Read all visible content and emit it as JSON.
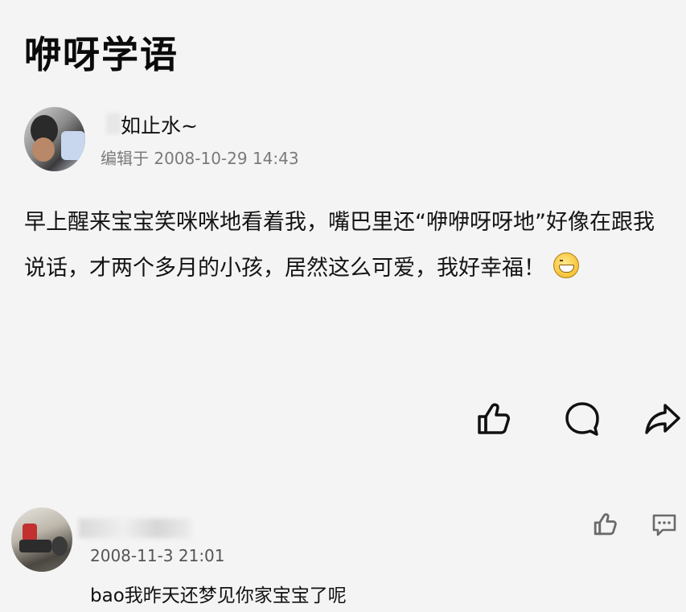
{
  "post": {
    "title": "咿呀学语",
    "author": {
      "name": "如止水~"
    },
    "edited_time": "编辑于 2008-10-29 14:43",
    "body": "早上醒来宝宝笑咪咪地看着我，嘴巴里还“咿咿呀呀地”好像在跟我说话，才两个多月的小孩，居然这么可爱，我好幸福！",
    "emoji_icon": "grinning-face-icon"
  },
  "actions": {
    "like_icon": "thumbs-up-icon",
    "comment_icon": "speech-bubble-icon",
    "share_icon": "share-arrow-icon"
  },
  "comment": {
    "time": "2008-11-3 21:01",
    "text": "bao我昨天还梦见你家宝宝了呢",
    "like_icon": "thumbs-up-icon",
    "reply_icon": "comment-dots-icon"
  }
}
